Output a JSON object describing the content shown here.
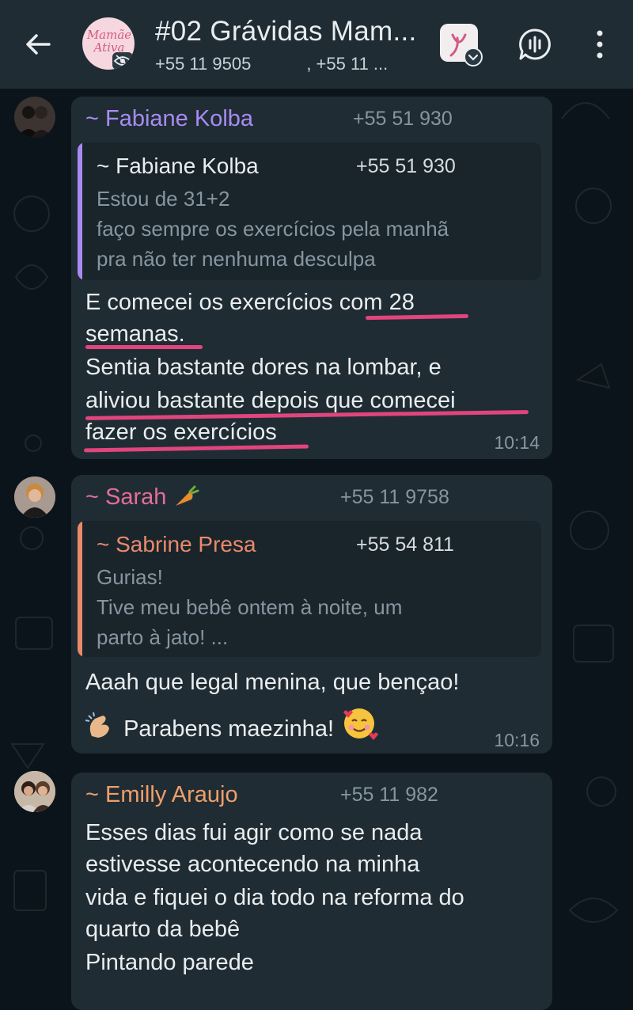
{
  "header": {
    "group_avatar_text": "Mamãe Ativa",
    "title": "#02 Grávidas Mam...",
    "members": "+55 11 9505",
    "members_more": ", +55 11 ...",
    "accent": "#1f2c34"
  },
  "messages": [
    {
      "sender": "~ Fabiane Kolba",
      "sender_color": "#a68cf2",
      "phone": "+55 51 930",
      "quote": {
        "name": "~ Fabiane Kolba",
        "phone": "+55 51 930",
        "lines": [
          "Estou de 31+2",
          "faço sempre os exercícios pela manhã",
          "pra não ter nenhuma desculpa"
        ],
        "bar_color": "#a68cf2"
      },
      "lines": [
        "E comecei os exercícios com 28",
        "semanas.",
        "Sentia bastante dores na lombar, e",
        "aliviou bastante depois que comecei",
        "fazer os exercícios"
      ],
      "time": "10:14"
    },
    {
      "sender": "~ Sarah",
      "sender_color": "#e56d9b",
      "phone": "+55 11 9758",
      "quote": {
        "name": "~ Sabrine Presa",
        "phone": "+55 54 811",
        "lines": [
          "Gurias!",
          "Tive meu bebê ontem à noite, um",
          "parto à jato! ..."
        ],
        "bar_color": "#e98b6b"
      },
      "lines": [
        "Aaah que legal menina, que bençao!",
        "Parabens maezinha!"
      ],
      "time": "10:16"
    },
    {
      "sender": "~ Emilly Araujo",
      "sender_color": "#ee9f6a",
      "phone": "+55 11 982",
      "lines": [
        "Esses dias fui agir como se nada",
        "estivesse acontecendo na minha",
        "vida e fiquei o dia todo na reforma do",
        "quarto da bebê",
        "Pintando parede"
      ]
    }
  ]
}
